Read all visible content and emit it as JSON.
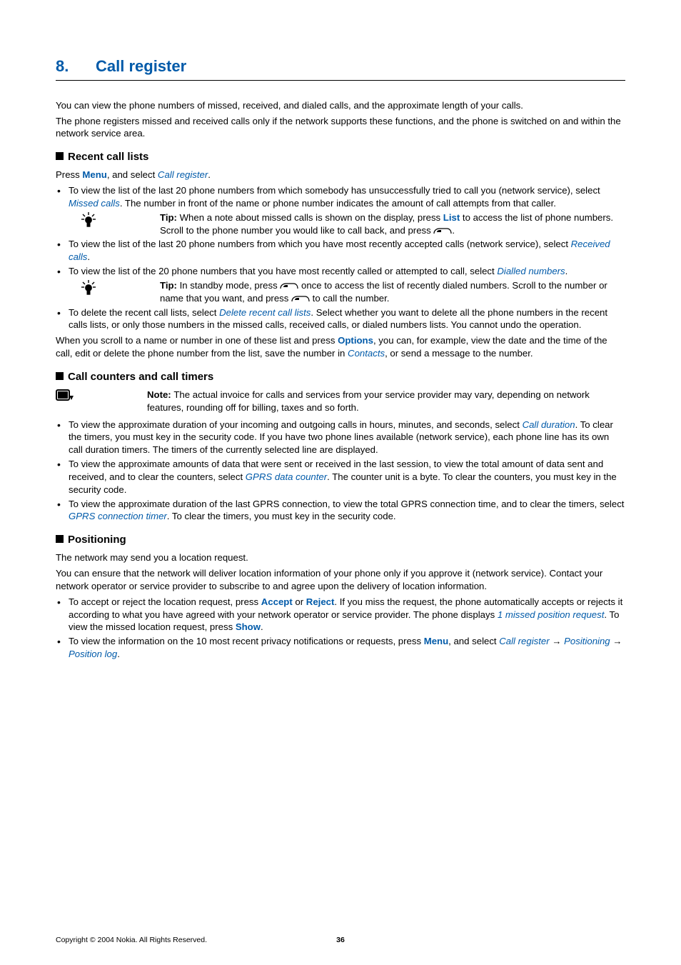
{
  "chapter": {
    "number": "8.",
    "title": "Call register"
  },
  "intro": {
    "p1": "You can view the phone numbers of missed, received, and dialed calls, and the approximate length of your calls.",
    "p2": "The phone registers missed and received calls only if the network supports these functions, and the phone is switched on and within the network service area."
  },
  "recent": {
    "heading": "Recent call lists",
    "press_a": "Press ",
    "menu": "Menu",
    "press_b": ", and select ",
    "call_register": "Call register",
    "press_c": ".",
    "b1a": "To view the list of the last 20 phone numbers from which somebody has unsuccessfully tried to call you (network service), select ",
    "b1_ref": "Missed calls",
    "b1b": ". The number in front of the name or phone number indicates the amount of call attempts from that caller.",
    "tip1a": "Tip: ",
    "tip1b": "When a note about missed calls is shown on the display, press ",
    "tip1_list": "List",
    "tip1c": " to access the list of phone numbers. Scroll to the phone number you would like to call back, and press ",
    "tip1d": ".",
    "b2a": "To view the list of the last 20 phone numbers from which you have most recently accepted calls (network service), select ",
    "b2_ref": "Received calls",
    "b2b": ".",
    "b3a": "To view the list of the 20 phone numbers that you have most recently called or attempted to call, select ",
    "b3_ref": "Dialled numbers",
    "b3b": ".",
    "tip2a": "Tip: ",
    "tip2b": "In standby mode, press ",
    "tip2c": " once to access the list of recently dialed numbers. Scroll to the number or name that you want, and press ",
    "tip2d": " to call the number.",
    "b4a": "To delete the recent call lists, select ",
    "b4_ref": "Delete recent call lists",
    "b4b": ". Select whether you want to delete all the phone numbers in the recent calls lists, or only those numbers in the missed calls, received calls, or dialed numbers lists. You cannot undo the operation.",
    "tail_a": "When you scroll to a name or number in one of these list and press ",
    "tail_opt": "Options",
    "tail_b": ", you can, for example, view the date and the time of the call, edit or delete the phone number from the list, save the number in ",
    "tail_contacts": "Contacts",
    "tail_c": ", or send a message to the number."
  },
  "counters": {
    "heading": "Call counters and call timers",
    "note_a": "Note:  ",
    "note_b": "The actual invoice for calls and services from your service provider may vary, depending on network features, rounding off for billing, taxes and so forth.",
    "b1a": "To view the approximate duration of your incoming and outgoing calls in hours, minutes, and seconds, select ",
    "b1_ref": "Call duration",
    "b1b": ". To clear the timers, you must key in the security code. If you have two phone lines available (network service), each phone line has its own call duration timers. The timers of the currently selected line are displayed.",
    "b2a": "To view the approximate amounts of data that were sent or received in the last session, to view the total amount of data sent and received, and to clear the counters, select ",
    "b2_ref": "GPRS data counter",
    "b2b": ". The counter unit is a byte. To clear the counters, you must key in the security code.",
    "b3a": "To view the approximate duration of the last GPRS connection, to view the total GPRS connection time, and to clear the timers, select ",
    "b3_ref": "GPRS connection timer",
    "b3b": ". To clear the timers, you must key in the security code."
  },
  "positioning": {
    "heading": "Positioning",
    "p1": "The network may send you a location request.",
    "p2": "You can ensure that the network will deliver location information of your phone only if you approve it (network service). Contact your network operator or service provider to subscribe to and agree upon the delivery of location information.",
    "b1a": "To accept or reject the location request, press ",
    "b1_accept": "Accept",
    "b1_or": " or ",
    "b1_reject": "Reject",
    "b1b": ". If you miss the request, the phone automatically accepts or rejects it according to what you have agreed with your network operator or service provider. The phone displays ",
    "b1_ref": "1 missed position request",
    "b1c": ". To view the missed location request, press ",
    "b1_show": "Show",
    "b1d": ".",
    "b2a": "To view the information on the 10 most recent privacy notifications or requests, press ",
    "b2_menu": "Menu",
    "b2b": ", and select ",
    "b2_ref1": "Call register",
    "b2_arrow1": " → ",
    "b2_ref2": "Positioning",
    "b2_arrow2": " → ",
    "b2_ref3": "Position log",
    "b2c": "."
  },
  "footer": {
    "copyright": "Copyright © 2004 Nokia. All Rights Reserved.",
    "page": "36"
  }
}
